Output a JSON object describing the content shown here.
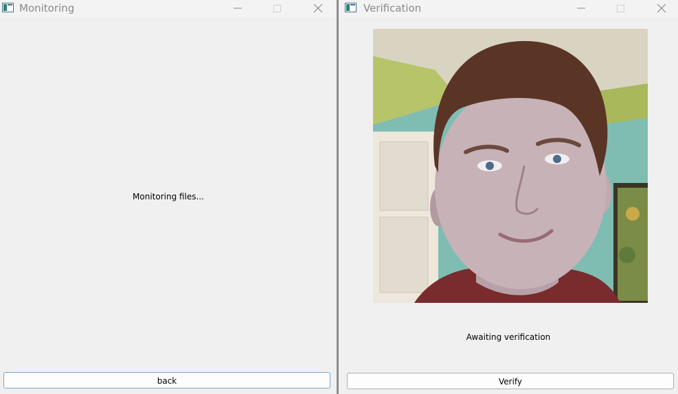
{
  "windows": {
    "monitoring": {
      "title": "Monitoring",
      "status_text": "Monitoring files...",
      "back_label": "back"
    },
    "verification": {
      "title": "Verification",
      "status_text": "Awaiting verification",
      "verify_label": "Verify"
    }
  },
  "controls": {
    "minimize_icon": "minimize-icon",
    "maximize_icon": "maximize-icon",
    "close_icon": "close-icon"
  },
  "colors": {
    "window_bg": "#f0f0f0",
    "title_text": "#8a8a8a",
    "button_focus_border": "#7aa7cf"
  }
}
